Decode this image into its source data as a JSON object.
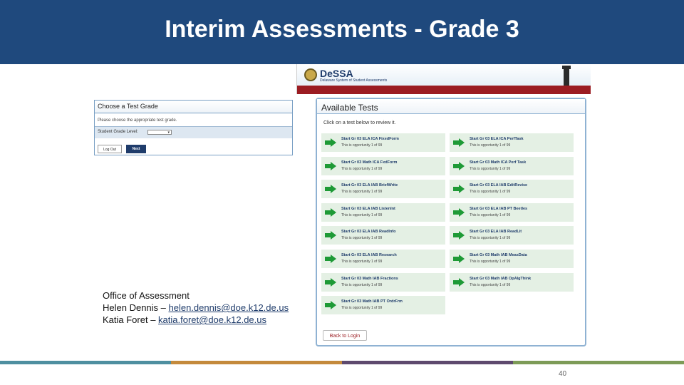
{
  "slide": {
    "title": "Interim Assessments - Grade 3",
    "page_number": "40",
    "stripe_colors": [
      "#4e8fa0",
      "#c48a3c",
      "#5e4a6e",
      "#7d9b57"
    ]
  },
  "grade_panel": {
    "header": "Choose a Test Grade",
    "instruction": "Please choose the appropriate test grade.",
    "level_label": "Student Grade Level:",
    "select_value": "",
    "logout_label": "Log Out",
    "next_label": "Next"
  },
  "dessa": {
    "name": "DeSSA",
    "subtitle": "Delaware System of Student Assessments"
  },
  "available_tests": {
    "header": "Available Tests",
    "instruction": "Click on a test below to review it.",
    "opportunity_text": "This is opportunity 1 of 99",
    "tests_left": [
      "Start Gr 03 ELA ICA FixedForm",
      "Start Gr 03 Math ICA FxdForm",
      "Start Gr 03 ELA IAB BriefWrite",
      "Start Gr 03 ELA IAB ListenInt",
      "Start Gr 03 ELA IAB ReadInfo",
      "Start Gr 03 ELA IAB Research",
      "Start Gr 03 Math IAB Fractions",
      "Start Gr 03 Math IAB PT OrdrFrm"
    ],
    "tests_right": [
      "Start Gr 03 ELA ICA PerfTask",
      "Start Gr 03 Math ICA Perf Task",
      "Start Gr 03 ELA IAB EditRevise",
      "Start Gr 03 ELA IAB PT Beetles",
      "Start Gr 03 ELA IAB ReadLit",
      "Start Gr 03 Math IAB MeasData",
      "Start Gr 03 Math IAB OpAlgThink"
    ],
    "back_label": "Back to Login"
  },
  "contact": {
    "office": "Office of Assessment",
    "person1_prefix": "Helen Dennis – ",
    "person1_email": "helen.dennis@doe.k12.de.us",
    "person2_prefix": "Katia Foret – ",
    "person2_email": "katia.foret@doe.k12.de.us"
  }
}
